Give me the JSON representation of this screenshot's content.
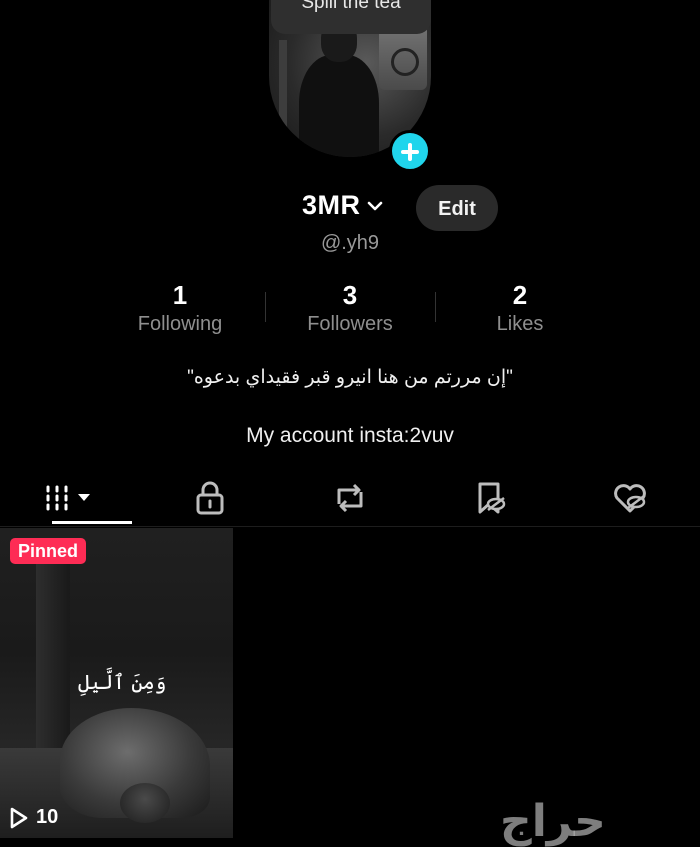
{
  "profile": {
    "tooltip": "Spill the tea",
    "name": "3MR",
    "edit_label": "Edit",
    "handle": "@.yh9",
    "bio_line1": "\"إن مررتم من هنا انيرو قبر فقيداي بدعوه\"",
    "bio_line2": "My account insta:2vuv"
  },
  "stats": [
    {
      "value": "1",
      "label": "Following"
    },
    {
      "value": "3",
      "label": "Followers"
    },
    {
      "value": "2",
      "label": "Likes"
    }
  ],
  "tabs": [
    {
      "name": "videos",
      "icon": "grid-icon",
      "active": true
    },
    {
      "name": "private",
      "icon": "lock-icon",
      "active": false
    },
    {
      "name": "reposts",
      "icon": "repost-icon",
      "active": false
    },
    {
      "name": "favorites",
      "icon": "bookmark-hidden-icon",
      "active": false
    },
    {
      "name": "liked",
      "icon": "heart-hidden-icon",
      "active": false
    }
  ],
  "videos": [
    {
      "badge": "Pinned",
      "caption": "وَمِنَ ٱلَّيلِ",
      "views": "10"
    }
  ],
  "watermark": "حراج",
  "colors": {
    "accent_pink": "#fe2c55",
    "accent_cyan": "#20d5ec",
    "background": "#000000"
  }
}
